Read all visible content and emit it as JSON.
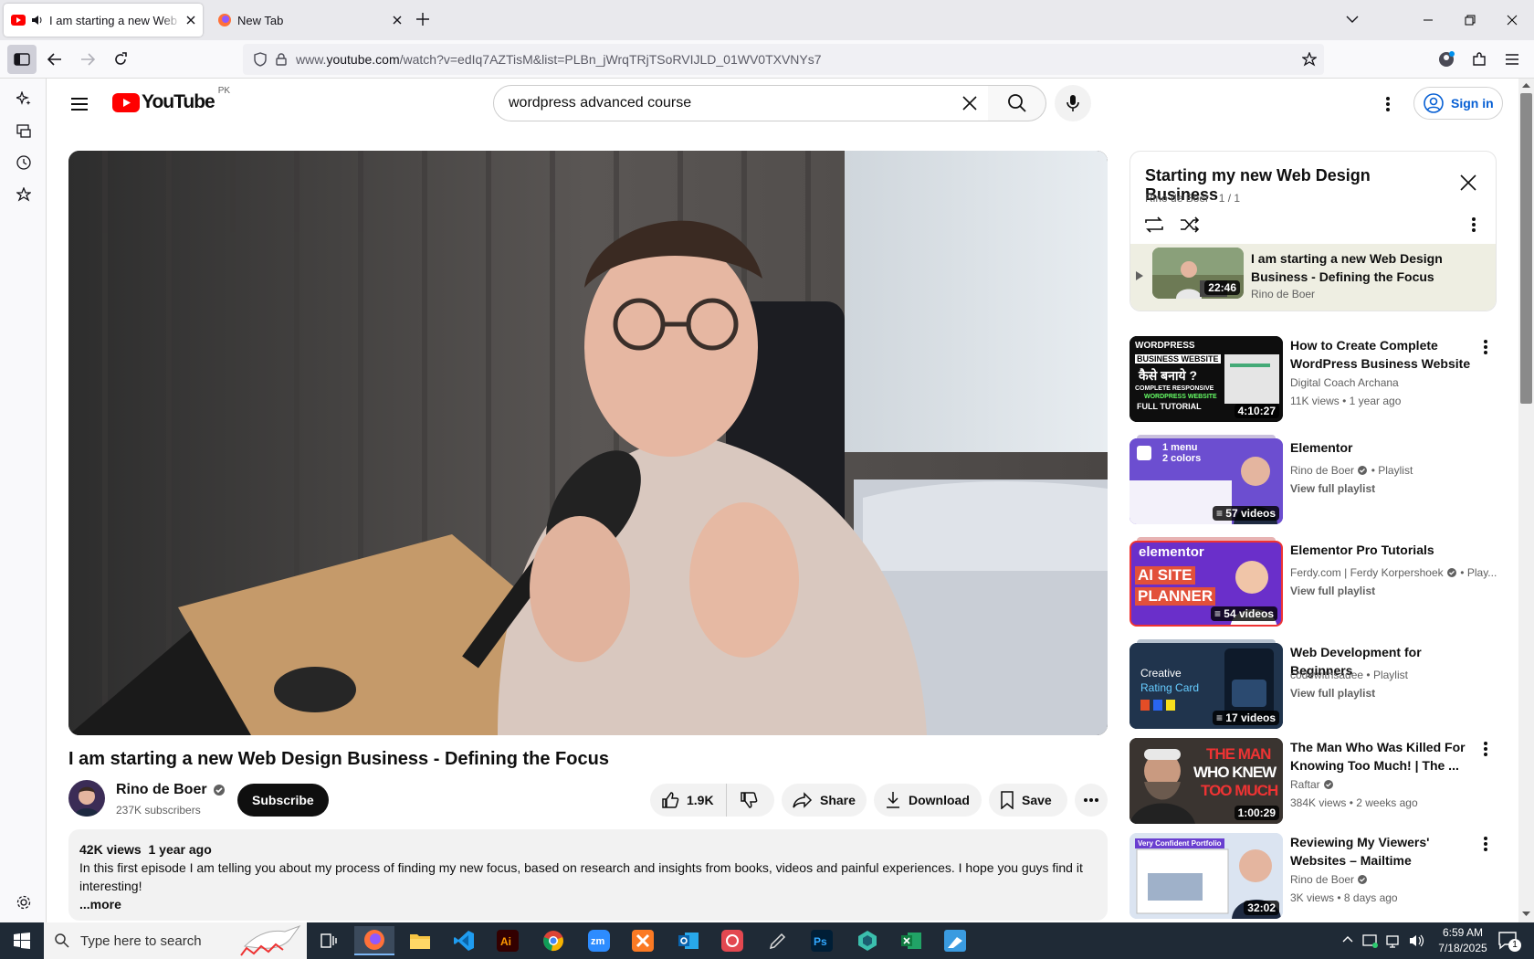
{
  "browser": {
    "tabs": [
      {
        "title": "I am starting a new Web Design Business - Defining the Focus",
        "active": true
      },
      {
        "title": "New Tab",
        "active": false
      }
    ],
    "url_prefix": "www.",
    "url_host": "youtube.com",
    "url_path": "/watch?v=edIq7AZTisM&list=PLBn_jWrqTRjTSoRVIJLD_01WV0TXVNYs7"
  },
  "youtube": {
    "logo_text": "YouTube",
    "region": "PK",
    "search_value": "wordpress advanced course",
    "sign_in": "Sign in"
  },
  "video": {
    "title": "I am starting a new Web Design Business - Defining the Focus",
    "channel": "Rino de Boer",
    "subscribers": "237K subscribers",
    "subscribe": "Subscribe",
    "likes": "1.9K",
    "share": "Share",
    "download": "Download",
    "save": "Save",
    "views": "42K views",
    "age": "1 year ago",
    "description": "In this first episode I am telling you about my process of finding my new focus, based on research and insights from books, videos and painful experiences. I hope you guys find it interesting!",
    "more": "...more"
  },
  "playlist": {
    "title": "Starting my new Web Design Business",
    "sub": "Rino de Boer - 1 / 1",
    "item": {
      "title": "I am starting a new Web Design Business - Defining the Focus",
      "channel": "Rino de Boer",
      "duration": "22:46"
    }
  },
  "recommendations": [
    {
      "title": "How to Create Complete WordPress Business Website ...",
      "channel": "Digital Coach Archana",
      "meta": "11K views • 1 year ago",
      "badge": "4:10:27",
      "thumb_text": [
        "WORDPRESS",
        "BUSINESS WEBSITE",
        "कैसे बनाये ?",
        "COMPLETE RESPONSIVE",
        "WORDPRESS WEBSITE",
        "FULL TUTORIAL"
      ]
    },
    {
      "title": "Elementor",
      "channel": "Rino de Boer",
      "kind": "Playlist",
      "view_full": "View full playlist",
      "badge": "57 videos",
      "thumb_text": [
        "1 menu",
        "2 colors"
      ]
    },
    {
      "title": "Elementor Pro Tutorials",
      "channel": "Ferdy.com | Ferdy Korpershoek",
      "kind": "Play...",
      "view_full": "View full playlist",
      "badge": "54 videos",
      "thumb_text": [
        "elementor",
        "AI SITE",
        "PLANNER"
      ]
    },
    {
      "title": "Web Development for Beginners",
      "channel": "codewithsadee",
      "kind": "Playlist",
      "view_full": "View full playlist",
      "badge": "17 videos",
      "thumb_text": [
        "Creative",
        "Rating Card"
      ]
    },
    {
      "title": "The Man Who Was Killed For Knowing Too Much! | The ...",
      "channel": "Raftar",
      "meta": "384K views • 2 weeks ago",
      "badge": "1:00:29",
      "thumb_text": [
        "THE MAN",
        "WHO KNEW",
        "TOO MUCH"
      ]
    },
    {
      "title": "Reviewing My Viewers' Websites – Mailtime",
      "channel": "Rino de Boer",
      "meta": "3K views • 8 days ago",
      "badge": "32:02",
      "thumb_text": [
        "Very Confident Portfolio"
      ]
    }
  ],
  "taskbar": {
    "search_placeholder": "Type here to search",
    "time": "6:59 AM",
    "date": "7/18/2025",
    "notification_count": "1"
  },
  "colors": {
    "youtube_red": "#ff0000",
    "link_blue": "#065fd4",
    "taskbar": "#1f2a36"
  }
}
